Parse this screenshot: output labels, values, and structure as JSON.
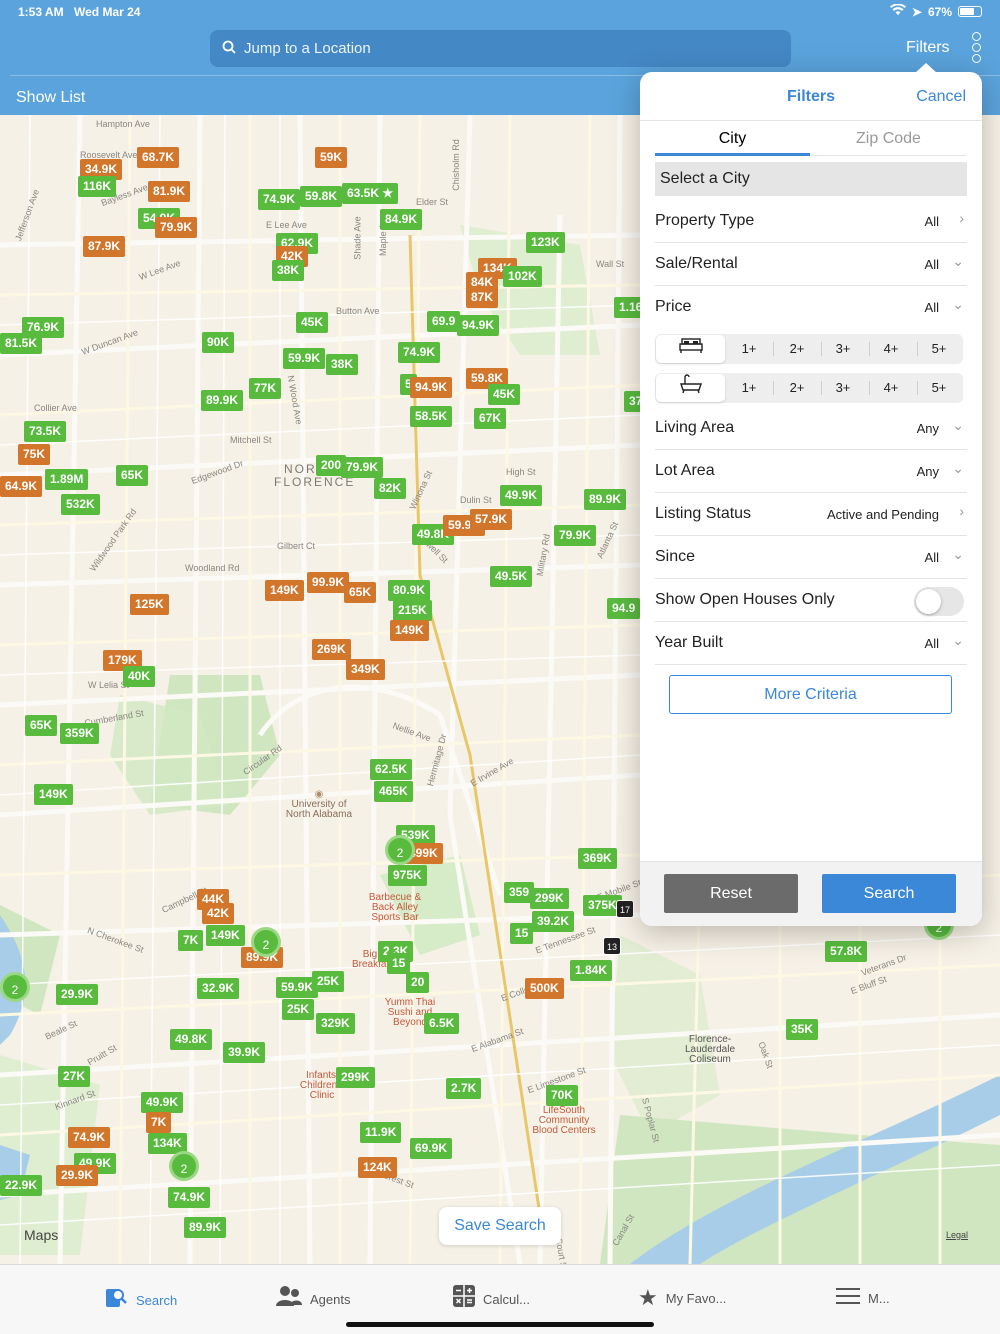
{
  "status": {
    "time": "1:53 AM",
    "date": "Wed Mar 24",
    "battery": "67%"
  },
  "header": {
    "search_placeholder": "Jump to a Location",
    "filters_label": "Filters",
    "show_list_label": "Show List"
  },
  "map": {
    "save_search_label": "Save Search",
    "maps_logo": "Maps",
    "legal": "Legal",
    "streets": [
      "Hampton Ave",
      "Roosevelt Ave",
      "Bayless Ave",
      "Jefferson Ave",
      "E Lee Ave",
      "W Lee Ave",
      "Chisholm Rd",
      "Elder St",
      "Wall St",
      "Button Ave",
      "W Duncan Ave",
      "Collier Ave",
      "Mitchell St",
      "Edgewood Dr",
      "High St",
      "Dulin St",
      "Gilbert Ct",
      "Woodland Rd",
      "Wildwood Park Rd",
      "W Lelia St",
      "Cumberland St",
      "Circular Rd",
      "Nellie Ave",
      "Hermitage Dr",
      "E Irvine Ave",
      "N Cherokee St",
      "Campbell St",
      "Beale St",
      "Pruitt St",
      "Kinnard St",
      "E Tennessee St",
      "E College St",
      "E Alabama St",
      "E Limestone St",
      "E Mobile St",
      "Veterans Dr",
      "E Bluff St",
      "Canal St",
      "S Poplar St",
      "Crest St",
      "Oak St",
      "N Wood Ave",
      "Shade Ave",
      "Maple Ave",
      "Howell St",
      "Winona St",
      "Military Rd",
      "Atlanta St",
      "S Court St"
    ],
    "city_label_1": "NORTH",
    "city_label_2": "FLORENCE",
    "pois": [
      {
        "name": "University of North Alabama"
      },
      {
        "name": "Barbecue & Back Alley Sports Bar"
      },
      {
        "name": "Big Breakfast"
      },
      {
        "name": "Yumm Thai Sushi and Beyond"
      },
      {
        "name": "Infants' Children's Clinic"
      },
      {
        "name": "LifeSouth Community Blood Centers"
      },
      {
        "name": "Florence-Lauderdale Coliseum"
      }
    ],
    "markers": [
      {
        "label": "34.9K",
        "color": "orange"
      },
      {
        "label": "68.7K",
        "color": "orange"
      },
      {
        "label": "116K",
        "color": "green"
      },
      {
        "label": "81.9K",
        "color": "orange"
      },
      {
        "label": "54.9K",
        "color": "green"
      },
      {
        "label": "79.9K",
        "color": "orange"
      },
      {
        "label": "87.9K",
        "color": "orange"
      },
      {
        "label": "59K",
        "color": "orange"
      },
      {
        "label": "74.9K",
        "color": "green"
      },
      {
        "label": "59.8K",
        "color": "green"
      },
      {
        "label": "63.5K ★",
        "color": "green"
      },
      {
        "label": "84.9K",
        "color": "green"
      },
      {
        "label": "62.9K",
        "color": "green"
      },
      {
        "label": "42K",
        "color": "orange"
      },
      {
        "label": "38K",
        "color": "green"
      },
      {
        "label": "123K",
        "color": "green"
      },
      {
        "label": "134K",
        "color": "orange"
      },
      {
        "label": "84K",
        "color": "orange"
      },
      {
        "label": "102K",
        "color": "green"
      },
      {
        "label": "87K",
        "color": "orange"
      },
      {
        "label": "1.16",
        "color": "green"
      },
      {
        "label": "76.9K",
        "color": "green"
      },
      {
        "label": "81.5K",
        "color": "green"
      },
      {
        "label": "45K",
        "color": "green"
      },
      {
        "label": "69.9",
        "color": "green"
      },
      {
        "label": "94.9K",
        "color": "green"
      },
      {
        "label": "90K",
        "color": "green"
      },
      {
        "label": "59.9K",
        "color": "green"
      },
      {
        "label": "38K",
        "color": "green"
      },
      {
        "label": "74.9K",
        "color": "green"
      },
      {
        "label": "5",
        "color": "green"
      },
      {
        "label": "94.9K",
        "color": "orange"
      },
      {
        "label": "59.8K",
        "color": "orange"
      },
      {
        "label": "77K",
        "color": "green"
      },
      {
        "label": "89.9K",
        "color": "green"
      },
      {
        "label": "45K",
        "color": "green"
      },
      {
        "label": "37",
        "color": "green"
      },
      {
        "label": "58.5K",
        "color": "green"
      },
      {
        "label": "67K",
        "color": "green"
      },
      {
        "label": "73.5K",
        "color": "green"
      },
      {
        "label": "75K",
        "color": "orange"
      },
      {
        "label": "200",
        "color": "green"
      },
      {
        "label": "79.9K",
        "color": "green"
      },
      {
        "label": "65K",
        "color": "green"
      },
      {
        "label": "1.89M",
        "color": "green"
      },
      {
        "label": "64.9K",
        "color": "orange"
      },
      {
        "label": "532K",
        "color": "green"
      },
      {
        "label": "82K",
        "color": "green"
      },
      {
        "label": "49.9K",
        "color": "green"
      },
      {
        "label": "89.9K",
        "color": "green"
      },
      {
        "label": "49.8K",
        "color": "green"
      },
      {
        "label": "59.9K",
        "color": "orange"
      },
      {
        "label": "57.9K",
        "color": "orange"
      },
      {
        "label": "79.9K",
        "color": "green"
      },
      {
        "label": "49.5K",
        "color": "green"
      },
      {
        "label": "149K",
        "color": "orange"
      },
      {
        "label": "99.9K",
        "color": "orange"
      },
      {
        "label": "65K",
        "color": "orange"
      },
      {
        "label": "80.9K",
        "color": "green"
      },
      {
        "label": "215K",
        "color": "green"
      },
      {
        "label": "149K",
        "color": "orange"
      },
      {
        "label": "125K",
        "color": "orange"
      },
      {
        "label": "94.9",
        "color": "green"
      },
      {
        "label": "269K",
        "color": "orange"
      },
      {
        "label": "349K",
        "color": "orange"
      },
      {
        "label": "179K",
        "color": "orange"
      },
      {
        "label": "40K",
        "color": "green"
      },
      {
        "label": "65K",
        "color": "green"
      },
      {
        "label": "359K",
        "color": "green"
      },
      {
        "label": "62.5K",
        "color": "green"
      },
      {
        "label": "465K",
        "color": "green"
      },
      {
        "label": "149K",
        "color": "green"
      },
      {
        "label": "539K",
        "color": "green"
      },
      {
        "label": "499K",
        "color": "orange"
      },
      {
        "label": "975K",
        "color": "green"
      },
      {
        "label": "369K",
        "color": "green"
      },
      {
        "label": "44K",
        "color": "orange"
      },
      {
        "label": "42K",
        "color": "orange"
      },
      {
        "label": "7K",
        "color": "green"
      },
      {
        "label": "149K",
        "color": "green"
      },
      {
        "label": "89.9K",
        "color": "orange"
      },
      {
        "label": "359",
        "color": "green"
      },
      {
        "label": "299K",
        "color": "green"
      },
      {
        "label": "375K",
        "color": "green"
      },
      {
        "label": "39.2K",
        "color": "green"
      },
      {
        "label": "15",
        "color": "green"
      },
      {
        "label": "2.3K",
        "color": "green"
      },
      {
        "label": "15",
        "color": "green"
      },
      {
        "label": "1.84K",
        "color": "green"
      },
      {
        "label": "57.8K",
        "color": "green"
      },
      {
        "label": "29.9K",
        "color": "green"
      },
      {
        "label": "32.9K",
        "color": "green"
      },
      {
        "label": "59.9K",
        "color": "green"
      },
      {
        "label": "25K",
        "color": "green"
      },
      {
        "label": "20",
        "color": "green"
      },
      {
        "label": "500K",
        "color": "orange"
      },
      {
        "label": "25K",
        "color": "green"
      },
      {
        "label": "329K",
        "color": "green"
      },
      {
        "label": "6.5K",
        "color": "green"
      },
      {
        "label": "35K",
        "color": "green"
      },
      {
        "label": "49.8K",
        "color": "green"
      },
      {
        "label": "39.9K",
        "color": "green"
      },
      {
        "label": "27K",
        "color": "green"
      },
      {
        "label": "299K",
        "color": "green"
      },
      {
        "label": "2.7K",
        "color": "green"
      },
      {
        "label": "70K",
        "color": "green"
      },
      {
        "label": "49.9K",
        "color": "green"
      },
      {
        "label": "7K",
        "color": "orange"
      },
      {
        "label": "134K",
        "color": "green"
      },
      {
        "label": "74.9K",
        "color": "orange"
      },
      {
        "label": "49.9K",
        "color": "green"
      },
      {
        "label": "11.9K",
        "color": "green"
      },
      {
        "label": "69.9K",
        "color": "green"
      },
      {
        "label": "29.9K",
        "color": "orange"
      },
      {
        "label": "124K",
        "color": "orange"
      },
      {
        "label": "22.9K",
        "color": "green"
      },
      {
        "label": "74.9K",
        "color": "green"
      },
      {
        "label": "89.9K",
        "color": "green"
      }
    ],
    "clusters": [
      "2",
      "2",
      "2",
      "2",
      "2"
    ],
    "transit_badges": [
      "13",
      "17"
    ]
  },
  "filters": {
    "title": "Filters",
    "cancel": "Cancel",
    "tabs": [
      "City",
      "Zip Code"
    ],
    "select_city": "Select a City",
    "rows": [
      {
        "label": "Property Type",
        "value": "All"
      },
      {
        "label": "Sale/Rental",
        "value": "All"
      },
      {
        "label": "Price",
        "value": "All"
      },
      {
        "label": "Living Area",
        "value": "Any"
      },
      {
        "label": "Lot Area",
        "value": "Any"
      },
      {
        "label": "Listing Status",
        "value": "Active and Pending"
      },
      {
        "label": "Since",
        "value": "All"
      },
      {
        "label": "Show Open Houses Only",
        "value": ""
      },
      {
        "label": "Year Built",
        "value": "All"
      }
    ],
    "room_options": [
      "1+",
      "2+",
      "3+",
      "4+",
      "5+"
    ],
    "more_criteria": "More Criteria",
    "reset": "Reset",
    "search": "Search",
    "open_houses_toggle": false
  },
  "tabbar": [
    {
      "label": "Search",
      "icon": "search-icon"
    },
    {
      "label": "Agents",
      "icon": "agents-icon"
    },
    {
      "label": "Calcul...",
      "icon": "calculator-icon"
    },
    {
      "label": "My Favo...",
      "icon": "star-icon"
    },
    {
      "label": "M...",
      "icon": "menu-icon"
    }
  ],
  "colors": {
    "header": "#5aa3dc",
    "accent": "#3b87d8",
    "marker_green": "#58bb3e",
    "marker_orange": "#d2762c"
  }
}
